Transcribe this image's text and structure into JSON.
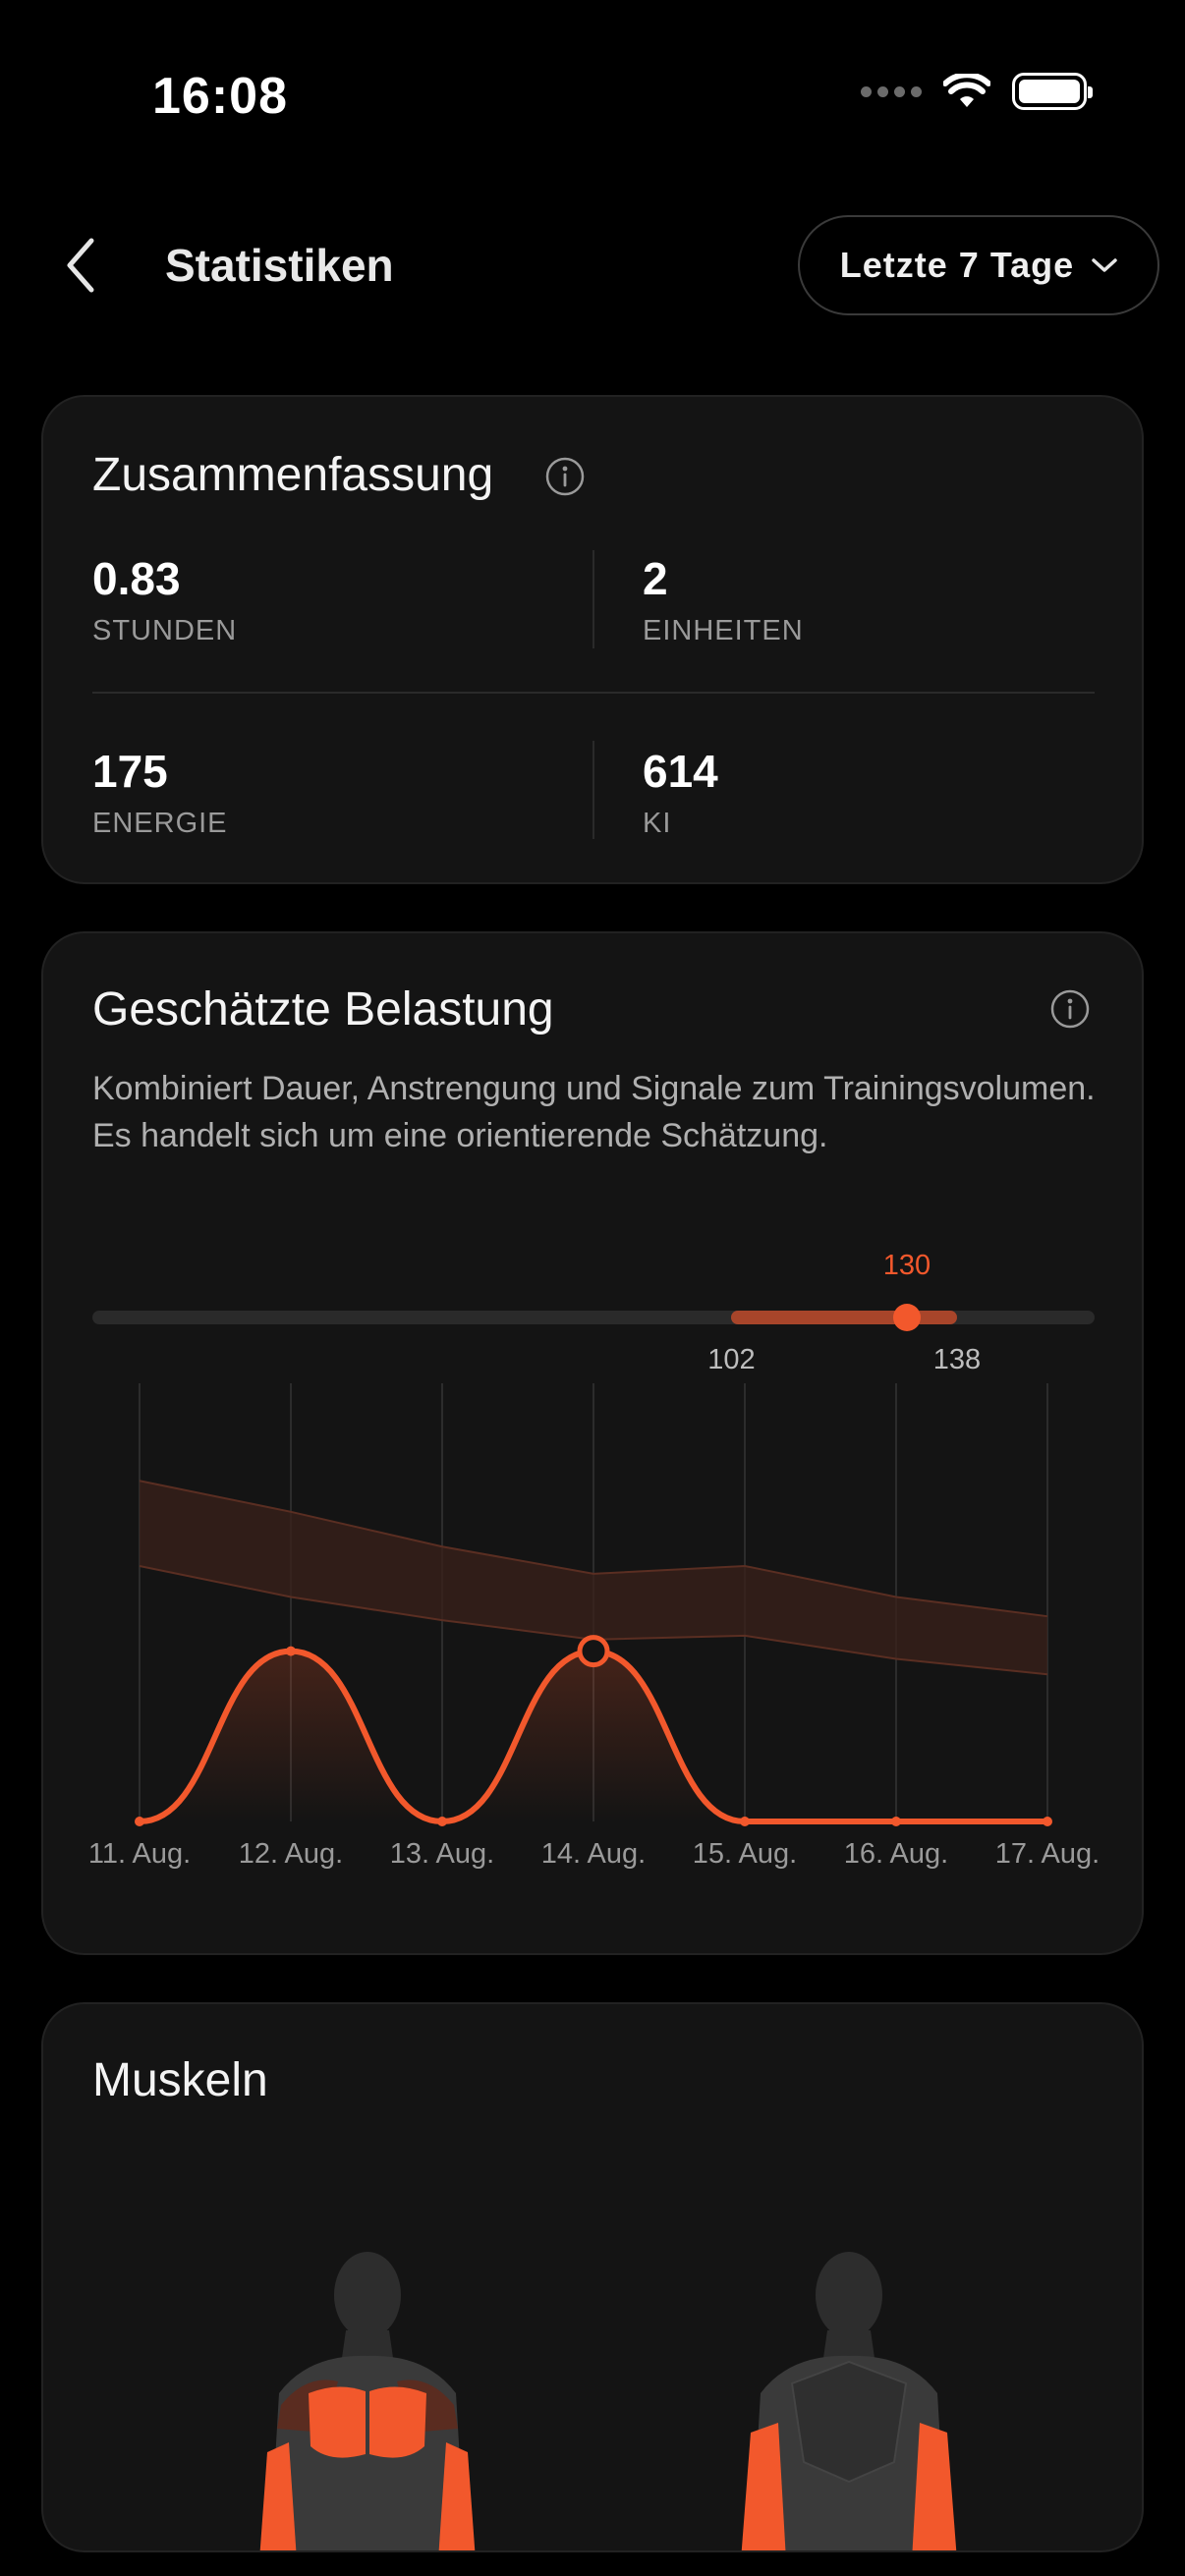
{
  "status": {
    "time": "16:08"
  },
  "header": {
    "title": "Statistiken",
    "range_label": "Letzte 7 Tage"
  },
  "summary": {
    "title": "Zusammenfassung",
    "metrics": [
      {
        "value": "0.83",
        "label": "STUNDEN"
      },
      {
        "value": "2",
        "label": "EINHEITEN"
      },
      {
        "value": "175",
        "label": "ENERGIE"
      },
      {
        "value": "614",
        "label": "KI"
      }
    ]
  },
  "load": {
    "title": "Geschätzte Belastung",
    "description": "Kombiniert Dauer, Anstrengung und Signale zum Trainingsvolumen. Es handelt sich um eine orientierende Schätzung.",
    "range": {
      "low": 102,
      "high": 138,
      "current": 130,
      "low_label": "102",
      "high_label": "138",
      "current_label": "130"
    }
  },
  "chart_data": {
    "type": "line",
    "categories": [
      "11. Aug.",
      "12. Aug.",
      "13. Aug.",
      "14. Aug.",
      "15. Aug.",
      "16. Aug.",
      "17. Aug."
    ],
    "ylim": [
      0,
      100
    ],
    "series": [
      {
        "values": [
          0,
          44,
          0,
          44,
          0,
          0,
          0
        ]
      }
    ],
    "band_upper": [
      88,
      80,
      71,
      64,
      66,
      58,
      53
    ],
    "band_lower": [
      66,
      58,
      52,
      47,
      48,
      42,
      38
    ],
    "highlight_index": 3,
    "accent_color": "#f2582c",
    "band_color": "#3a2019"
  },
  "muscles": {
    "title": "Muskeln"
  }
}
